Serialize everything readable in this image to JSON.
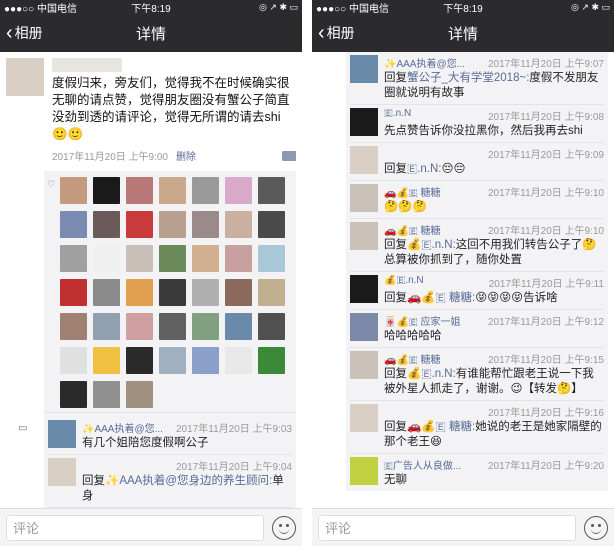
{
  "status": {
    "carrier": "●●●○○ 中国电信",
    "time": "下午8:19",
    "icons": "◎ ↗ ✱ ▭"
  },
  "nav": {
    "back": "相册",
    "title": "详情"
  },
  "post": {
    "text": "度假归来，旁友们，觉得我不在时候确实很无聊的请点赞，觉得朋友圈没有蟹公子简直没劲到透的请评论，觉得无所谓的请去shi 🙂🙂",
    "time": "2017年11月20日 上午9:00",
    "delete": "删除"
  },
  "likes_avatar_colors": [
    "#c49a7e",
    "#1a1a1a",
    "#b87878",
    "#c9a88c",
    "#9a9a9a",
    "#d9a9c9",
    "#5a5a5a",
    "#7a8ab0",
    "#6a5a5a",
    "#c93a3a",
    "#b8a090",
    "#9a8a8a",
    "#c9b0a0",
    "#4a4a4a",
    "#a0a0a0",
    "#f0f0f0",
    "#c8c0b8",
    "#6a8a5a",
    "#d0b090",
    "#c9a0a0",
    "#a8c8d8",
    "#c03030",
    "#8a8a8a",
    "#e0a050",
    "#3a3a3a",
    "#b0b0b0",
    "#8a6a5a",
    "#c0b090",
    "#a08070",
    "#90a0b0",
    "#d0a0a0",
    "#606060",
    "#80a080",
    "#6a8aaa",
    "#505050",
    "#e0e0e0",
    "#f0c040",
    "#2a2a2a",
    "#a0b0c0",
    "#8aa0c8",
    "#e8e8e8",
    "#3a8a3a",
    "#2a2a2a",
    "#909090",
    "#a09080"
  ],
  "left_comments": [
    {
      "name": "✨AAA执着@您...",
      "time": "2017年11月20日 上午9:03",
      "text": "有几个姐陪您度假啊公子",
      "av": "#6a8aaa"
    },
    {
      "name": "",
      "time": "2017年11月20日 上午9:04",
      "reply_prefix": "回复",
      "reply_to": "✨AAA执着@您身边的养生顾问:",
      "text": "单身",
      "av": "#d9cfc4"
    },
    {
      "name": "",
      "time": "",
      "reply_prefix": "",
      "reply_to": "",
      "text": "",
      "av": "#c0b0a0"
    }
  ],
  "right_comments": [
    {
      "name": "✨AAA执着@您...",
      "time": "2017年11月20日 上午9:07",
      "reply_prefix": "回复",
      "reply_to": "蟹公子_大有学堂2018~:",
      "text": "度假不发朋友圈就说明有故事",
      "av": "#6a8aaa"
    },
    {
      "name": "🇪.n.N",
      "time": "2017年11月20日 上午9:08",
      "reply_prefix": "",
      "reply_to": "",
      "text": "先点赞告诉你没拉黑你，然后我再去shi",
      "av": "#1a1a1a"
    },
    {
      "name": "",
      "time": "2017年11月20日 上午9:09",
      "reply_prefix": "回复",
      "reply_to": "🇪.n.N:",
      "text": "😔😔",
      "av": "#d9cfc4"
    },
    {
      "name": "🚗💰🇪 糖糖",
      "time": "2017年11月20日 上午9:10",
      "reply_prefix": "",
      "reply_to": "",
      "text": "🤔🤔🤔",
      "av": "#c9c0b8"
    },
    {
      "name": "🚗💰🇪 糖糖",
      "time": "2017年11月20日 上午9:10",
      "reply_prefix": "回复",
      "reply_to": "💰🇪.n.N:",
      "text": "这回不用我们转告公子了🤔总算被你抓到了，随你处置",
      "av": "#c9c0b8"
    },
    {
      "name": "💰🇪.n.N",
      "time": "2017年11月20日 上午9:11",
      "reply_prefix": "回复",
      "reply_to": "🚗💰🇪 糖糖:",
      "text": "😝😝😝😝告诉啥",
      "av": "#1a1a1a"
    },
    {
      "name": "🀄💰🇪 应家一姐",
      "time": "2017年11月20日 上午9:12",
      "reply_prefix": "",
      "reply_to": "",
      "text": "哈哈哈哈哈",
      "av": "#7a8aa8"
    },
    {
      "name": "🚗💰🇪 糖糖",
      "time": "2017年11月20日 上午9:15",
      "reply_prefix": "回复",
      "reply_to": "💰🇪.n.N:",
      "text": "有谁能帮忙跟老王说一下我被外星人抓走了，谢谢。😉【转发🤔】",
      "av": "#c9c0b8"
    },
    {
      "name": "",
      "time": "2017年11月20日 上午9:16",
      "reply_prefix": "回复",
      "reply_to": "🚗💰🇪 糖糖:",
      "text": "她说的老王是她家隔壁的那个老王😆",
      "av": "#d9cfc4"
    },
    {
      "name": "🇪广告人从良做...",
      "time": "2017年11月20日 上午9:20",
      "reply_prefix": "",
      "reply_to": "",
      "text": "无聊",
      "av": "#c0d040"
    }
  ],
  "bottom": {
    "placeholder": "评论"
  }
}
